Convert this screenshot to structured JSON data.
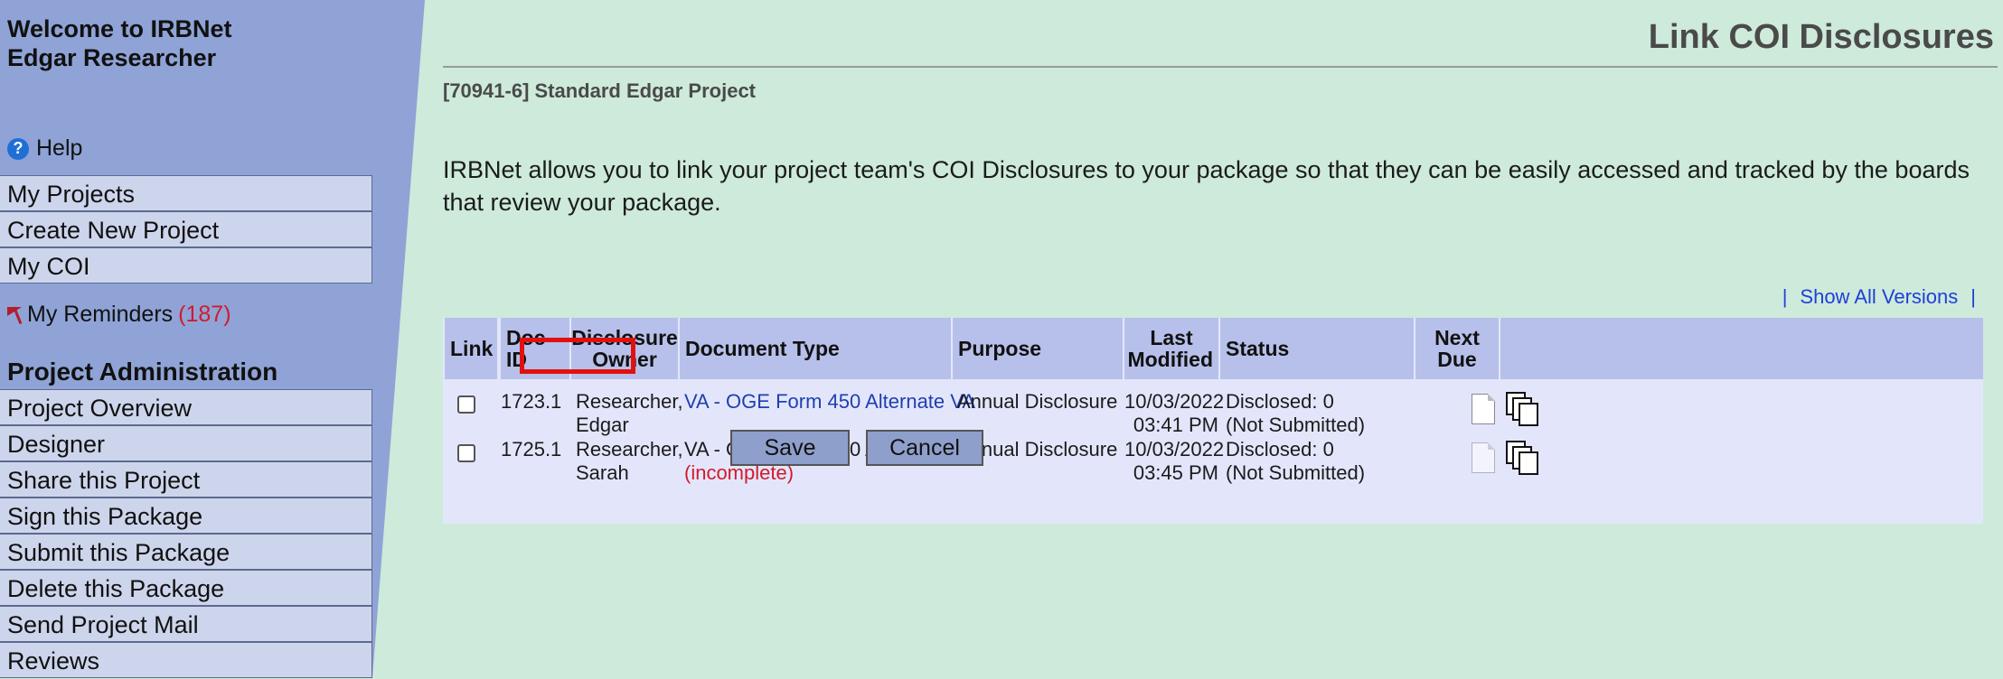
{
  "sidebar": {
    "welcome_line1": "Welcome to IRBNet",
    "welcome_line2": "Edgar Researcher",
    "help_label": "Help",
    "menu_top": [
      "My Projects",
      "Create New Project",
      "My COI"
    ],
    "reminders_label": "My Reminders",
    "reminders_count": "(187)",
    "section_title": "Project Administration",
    "menu_project": [
      "Project Overview",
      "Designer",
      "Share this Project",
      "Sign this Package",
      "Submit this Package",
      "Delete this Package",
      "Send Project Mail",
      "Reviews"
    ]
  },
  "main": {
    "page_title": "Link COI Disclosures",
    "project_name": "[70941-6] Standard Edgar Project",
    "intro": "IRBNet allows you to link your project team's COI Disclosures to your package so that they can be easily accessed and tracked by the boards that review your package.",
    "show_all_versions": "Show All Versions",
    "separator": "|"
  },
  "table": {
    "headers": {
      "link": "Link",
      "doc_id": "Doc ID",
      "owner_line1": "Disclosure",
      "owner_line2": "Owner",
      "doc_type": "Document Type",
      "purpose": "Purpose",
      "modified_line1": "Last",
      "modified_line2": "Modified",
      "status": "Status",
      "next_due_line1": "Next",
      "next_due_line2": "Due"
    },
    "rows": [
      {
        "doc_id": "1723.1",
        "owner_line1": "Researcher,",
        "owner_line2": "Edgar",
        "doc_type": "VA - OGE Form 450 Alternate VA",
        "doc_type_note": "",
        "purpose": "Annual Disclosure",
        "date": "10/03/2022",
        "time": "03:41 PM",
        "status_line1": "Disclosed: 0",
        "status_line2": "(Not Submitted)"
      },
      {
        "doc_id": "1725.1",
        "owner_line1": "Researcher,",
        "owner_line2": "Sarah",
        "doc_type": "VA - OGE Form 450 Alternate VA",
        "doc_type_note": "(incomplete)",
        "purpose": "Annual Disclosure",
        "date": "10/03/2022",
        "time": "03:45 PM",
        "status_line1": "Disclosed: 0",
        "status_line2": "(Not Submitted)"
      }
    ]
  },
  "buttons": {
    "save": "Save",
    "cancel": "Cancel"
  },
  "icons": {
    "help": "question-circle-icon",
    "reminders": "flag-icon",
    "view": "document-icon",
    "copy": "copy-icon"
  },
  "colors": {
    "sidebar_bg": "#8fa3d6",
    "menu_item_bg": "#cdd5ec",
    "main_bg": "#cdeadb",
    "table_header_bg": "#b7c0ea",
    "table_row_bg": "#e3e6fb",
    "link": "#1f3fb0",
    "alert_red": "#d11b2c",
    "highlight_box": "#e21010"
  }
}
